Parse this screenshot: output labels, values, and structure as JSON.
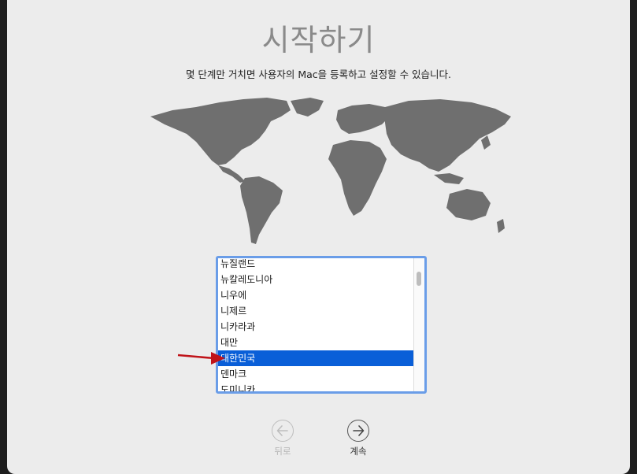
{
  "window": {
    "title": "시작하기",
    "subtitle": "몇 단계만 거치면 사용자의 Mac을 등록하고 설정할 수 있습니다."
  },
  "map": {
    "icon": "world-map",
    "fill": "#6f6f6f"
  },
  "country_list": {
    "items": [
      "뉴질랜드",
      "뉴칼레도니아",
      "니우에",
      "니제르",
      "니카라과",
      "대만",
      "대한민국",
      "덴마크",
      "도미니카"
    ],
    "selected": "대한민국",
    "selected_color": "#0a5fd8"
  },
  "annotation": {
    "icon": "red-arrow-icon",
    "color": "#c0141a"
  },
  "nav": {
    "back_label": "뒤로",
    "back_icon": "arrow-left-circle-icon",
    "next_label": "계속",
    "next_icon": "arrow-right-circle-icon"
  }
}
